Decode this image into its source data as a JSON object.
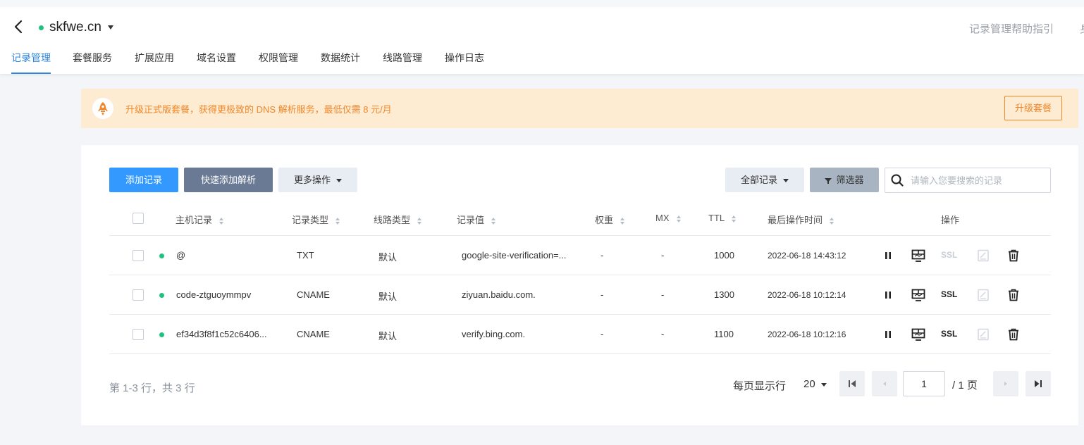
{
  "header": {
    "domain": "skfwe.cn",
    "help_link": "记录管理帮助指引",
    "cut_text": "身"
  },
  "tabs": [
    "记录管理",
    "套餐服务",
    "扩展应用",
    "域名设置",
    "权限管理",
    "数据统计",
    "线路管理",
    "操作日志"
  ],
  "banner": {
    "text": "升级正式版套餐，获得更极致的 DNS 解析服务，最低仅需 8 元/月",
    "button": "升级套餐"
  },
  "toolbar": {
    "add": "添加记录",
    "quick_add": "快速添加解析",
    "more": "更多操作",
    "all_records": "全部记录",
    "filter": "筛选器",
    "search_placeholder": "请输入您要搜索的记录"
  },
  "columns": {
    "host": "主机记录",
    "type": "记录类型",
    "line": "线路类型",
    "value": "记录值",
    "weight": "权重",
    "mx": "MX",
    "ttl": "TTL",
    "time": "最后操作时间",
    "actions": "操作"
  },
  "rows": [
    {
      "host": "@",
      "type": "TXT",
      "line": "默认",
      "value": "google-site-verification=...",
      "weight": "-",
      "mx": "-",
      "ttl": "1000",
      "time": "2022-06-18 14:43:12",
      "ssl": "SSL",
      "ssl_enabled": false
    },
    {
      "host": "code-ztguoymmpv",
      "type": "CNAME",
      "line": "默认",
      "value": "ziyuan.baidu.com.",
      "weight": "-",
      "mx": "-",
      "ttl": "1300",
      "time": "2022-06-18 10:12:14",
      "ssl": "SSL",
      "ssl_enabled": true
    },
    {
      "host": "ef34d3f8f1c52c6406...",
      "type": "CNAME",
      "line": "默认",
      "value": "verify.bing.com.",
      "weight": "-",
      "mx": "-",
      "ttl": "1100",
      "time": "2022-06-18 10:12:16",
      "ssl": "SSL",
      "ssl_enabled": true
    }
  ],
  "footer": {
    "range": "第 1-3 行，共 3 行",
    "per_page_label": "每页显示行",
    "per_page": "20",
    "page": "1",
    "total_pages": "/ 1 页"
  },
  "colors": {
    "accent": "#3399ff",
    "status_green": "#1fc27d",
    "banner_orange": "#f0872a"
  }
}
